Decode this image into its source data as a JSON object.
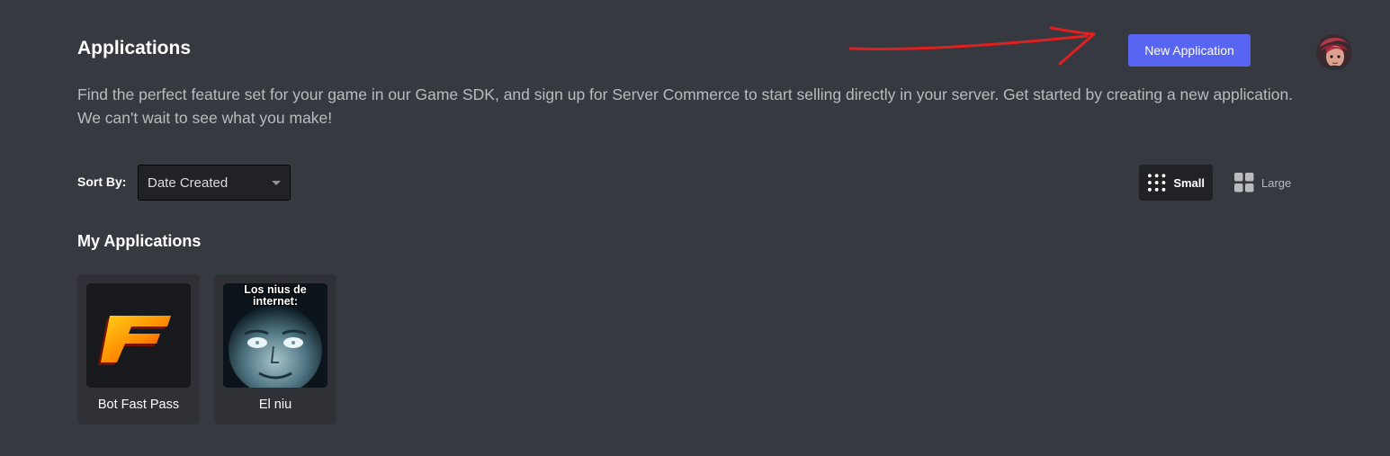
{
  "header": {
    "title": "Applications",
    "description": "Find the perfect feature set for your game in our Game SDK, and sign up for Server Commerce to start selling directly in your server. Get started by creating a new application. We can't wait to see what you make!",
    "new_app_label": "New Application"
  },
  "sort": {
    "label": "Sort By:",
    "selected": "Date Created"
  },
  "view_toggle": {
    "small_label": "Small",
    "large_label": "Large",
    "active": "small"
  },
  "apps_section": {
    "title": "My Applications",
    "apps": [
      {
        "name": "Bot Fast Pass",
        "icon": "orange-f-logo"
      },
      {
        "name": "El niu",
        "icon_caption": "Los nius de internet:",
        "icon": "meme-face-image"
      }
    ]
  },
  "colors": {
    "background": "#36393f",
    "primary_button": "#5865f2",
    "card": "#2f3136",
    "annotation_arrow": "#e02020"
  },
  "icons": [
    "small-grid-icon",
    "large-grid-icon",
    "user-avatar",
    "red-arrow-annotation"
  ]
}
